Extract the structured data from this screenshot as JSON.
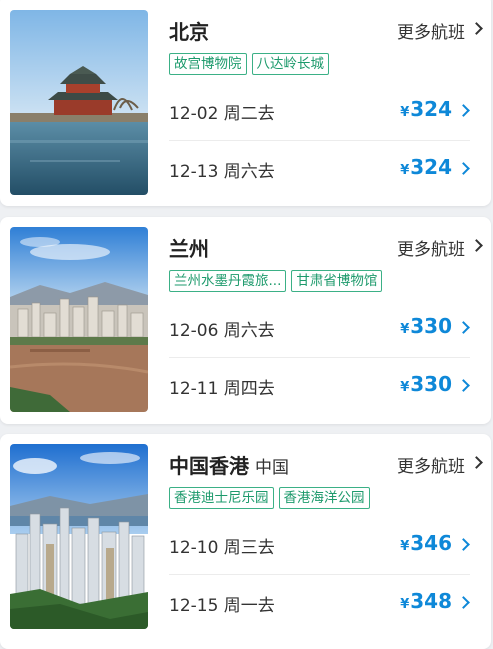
{
  "cards": [
    {
      "city": "北京",
      "country": "",
      "more_label": "更多航班",
      "tags": [
        "故宫博物院",
        "八达岭长城"
      ],
      "flights": [
        {
          "date": "12-02 周二去",
          "currency": "¥",
          "price": "324"
        },
        {
          "date": "12-13 周六去",
          "currency": "¥",
          "price": "324"
        }
      ]
    },
    {
      "city": "兰州",
      "country": "",
      "more_label": "更多航班",
      "tags": [
        "兰州水墨丹霞旅...",
        "甘肃省博物馆"
      ],
      "flights": [
        {
          "date": "12-06 周六去",
          "currency": "¥",
          "price": "330"
        },
        {
          "date": "12-11 周四去",
          "currency": "¥",
          "price": "330"
        }
      ]
    },
    {
      "city": "中国香港",
      "country": "中国",
      "more_label": "更多航班",
      "tags": [
        "香港迪士尼乐园",
        "香港海洋公园"
      ],
      "flights": [
        {
          "date": "12-10 周三去",
          "currency": "¥",
          "price": "346"
        },
        {
          "date": "12-15 周一去",
          "currency": "¥",
          "price": "348"
        }
      ]
    }
  ],
  "colors": {
    "price": "#0e88d8",
    "tag": "#1d9a6c",
    "background": "#eef0f3"
  }
}
